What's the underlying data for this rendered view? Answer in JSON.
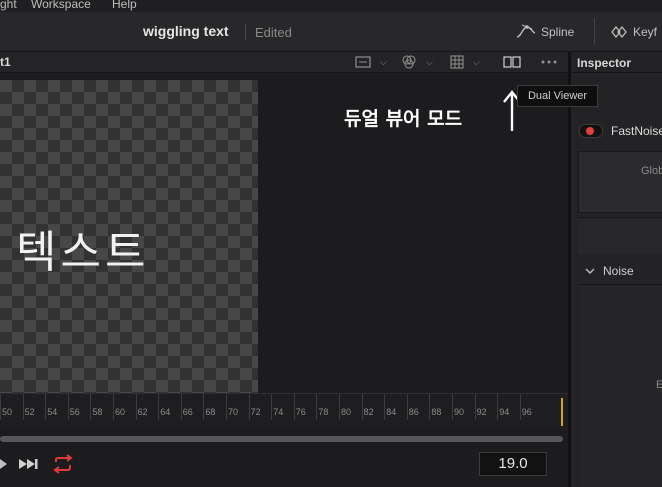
{
  "menubar": {
    "items": [
      "ght",
      "Workspace",
      "Help"
    ]
  },
  "titlebar": {
    "project_title": "wiggling text",
    "status": "Edited"
  },
  "toolbar": {
    "spline_label": "Spline",
    "keyframes_label": "Keyf"
  },
  "viewer": {
    "name": "t1",
    "canvas_text": "텍스트",
    "tooltip": "Dual Viewer",
    "annotation": "듀얼 뷰어 모드"
  },
  "ruler": {
    "ticks": [
      "50",
      "52",
      "54",
      "56",
      "58",
      "60",
      "62",
      "64",
      "66",
      "68",
      "70",
      "72",
      "74",
      "76",
      "78",
      "80",
      "82",
      "84",
      "86",
      "88",
      "90",
      "92",
      "94",
      "96"
    ]
  },
  "transport": {
    "current_frame": "19.0"
  },
  "inspector": {
    "title": "Inspector",
    "node_name": "FastNoise",
    "global_label": "Glob",
    "section_noise": "Noise",
    "row_label": "E"
  },
  "colors": {
    "accent": "#d8a520",
    "loop": "#e03a3a",
    "node_dot": "#e04040"
  }
}
